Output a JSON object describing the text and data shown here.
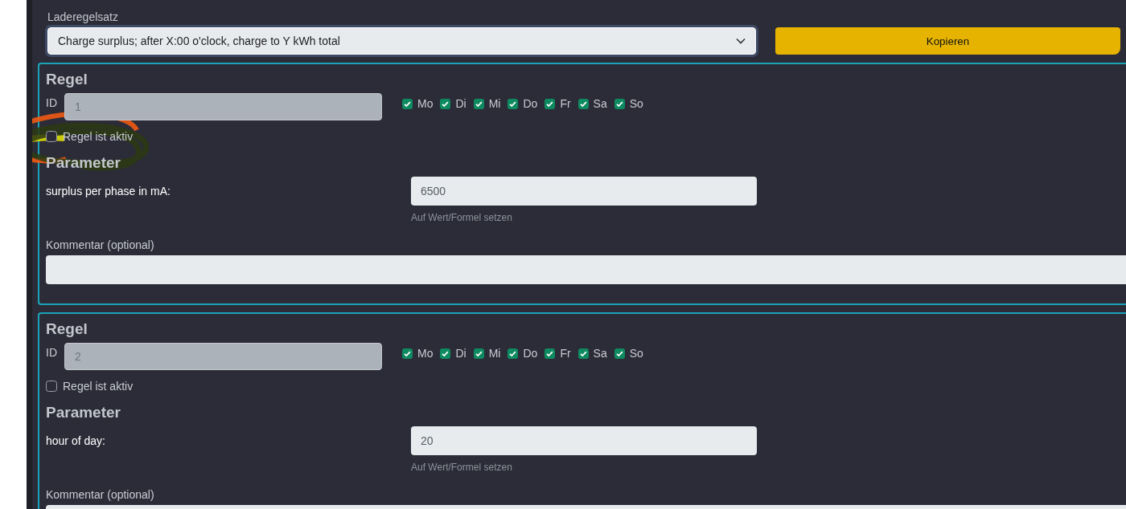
{
  "ruleset": {
    "label": "Laderegelsatz",
    "value": "Charge surplus; after X:00 o'clock, charge to Y kWh total",
    "copy_button": "Kopieren"
  },
  "rules": [
    {
      "heading": "Regel",
      "id_label": "ID",
      "id_value": "1",
      "days": [
        {
          "label": "Mo",
          "checked": true
        },
        {
          "label": "Di",
          "checked": true
        },
        {
          "label": "Mi",
          "checked": true
        },
        {
          "label": "Do",
          "checked": true
        },
        {
          "label": "Fr",
          "checked": true
        },
        {
          "label": "Sa",
          "checked": true
        },
        {
          "label": "So",
          "checked": true
        }
      ],
      "active": {
        "label": "Regel ist aktiv",
        "checked": false
      },
      "annotated": true,
      "parameters_heading": "Parameter",
      "parameters": [
        {
          "label": "surplus per phase in mA:",
          "value": "6500",
          "hint": "Auf Wert/Formel setzen"
        }
      ],
      "comment_label": "Kommentar (optional)"
    },
    {
      "heading": "Regel",
      "id_label": "ID",
      "id_value": "2",
      "days": [
        {
          "label": "Mo",
          "checked": true
        },
        {
          "label": "Di",
          "checked": true
        },
        {
          "label": "Mi",
          "checked": true
        },
        {
          "label": "Do",
          "checked": true
        },
        {
          "label": "Fr",
          "checked": true
        },
        {
          "label": "Sa",
          "checked": true
        },
        {
          "label": "So",
          "checked": true
        }
      ],
      "active": {
        "label": "Regel ist aktiv",
        "checked": false
      },
      "annotated": false,
      "parameters_heading": "Parameter",
      "parameters": [
        {
          "label": "hour of day:",
          "value": "20",
          "hint": "Auf Wert/Formel setzen"
        }
      ],
      "comment_label": "Kommentar (optional)"
    }
  ]
}
